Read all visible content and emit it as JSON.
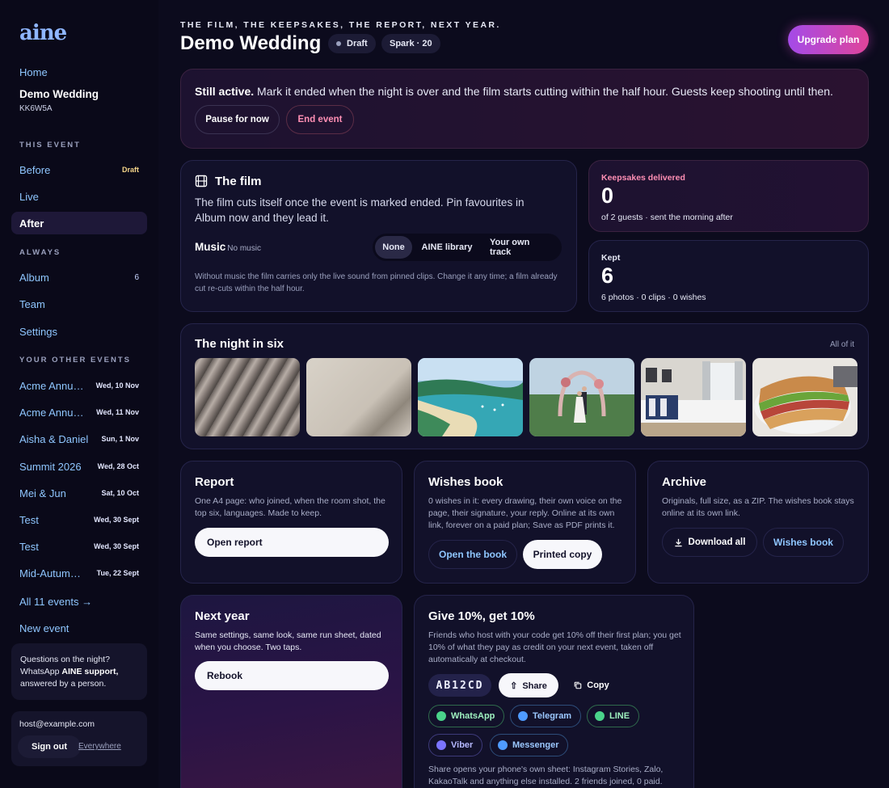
{
  "brand": {
    "logo": "aine"
  },
  "sidebar": {
    "home": "Home",
    "event_title": "Demo Wedding",
    "event_code": "KK6W5A",
    "this_event_label": "THIS EVENT",
    "this_event": [
      {
        "label": "Before",
        "badge": "Draft"
      },
      {
        "label": "Live"
      },
      {
        "label": "After",
        "active": true
      }
    ],
    "always_label": "ALWAYS",
    "always": [
      {
        "label": "Album",
        "count": "6"
      },
      {
        "label": "Team"
      },
      {
        "label": "Settings"
      }
    ],
    "other_label": "YOUR OTHER EVENTS",
    "other_events": [
      {
        "name": "Acme Annual ...",
        "date": "Wed, 10 Nov"
      },
      {
        "name": "Acme Annual ...",
        "date": "Wed, 11 Nov"
      },
      {
        "name": "Aisha & Daniel",
        "date": "Sun, 1 Nov"
      },
      {
        "name": "Summit 2026",
        "date": "Wed, 28 Oct"
      },
      {
        "name": "Mei & Jun",
        "date": "Sat, 10 Oct"
      },
      {
        "name": "Test",
        "date": "Wed, 30 Sept"
      },
      {
        "name": "Test",
        "date": "Wed, 30 Sept"
      },
      {
        "name": "Mid-Autumn ...",
        "date": "Tue, 22 Sept"
      }
    ],
    "all_events": "All 11 events →",
    "new_event": "New event",
    "support_line1": "Questions on the night?",
    "support_line2_pre": "WhatsApp ",
    "support_line2_bold": "AINE support,",
    "support_line3": "answered by a person.",
    "email": "host@example.com",
    "sign_out": "Sign out",
    "everywhere": "Everywhere"
  },
  "header": {
    "eyebrow": "THE FILM, THE KEEPSAKES, THE REPORT, NEXT YEAR.",
    "title": "Demo Wedding",
    "status_pill": "Draft",
    "plan_pill": "Spark · 20",
    "upgrade": "Upgrade plan"
  },
  "active_banner": {
    "bold": "Still active.",
    "text": " Mark it ended when the night is over and the film starts cutting within the half hour. Guests keep shooting until then.",
    "pause": "Pause for now",
    "end": "End event"
  },
  "film": {
    "title": "The film",
    "desc": "The film cuts itself once the event is marked ended. Pin favourites in Album now and they lead it.",
    "music_label": "Music",
    "music_sub": "No music",
    "options": [
      "None",
      "AINE library",
      "Your own track"
    ],
    "selected": "None",
    "note": "Without music the film carries only the live sound from pinned clips. Change it any time; a film already cut re-cuts within the half hour."
  },
  "keepsakes": {
    "label": "Keepsakes delivered",
    "value": "0",
    "sub": "of 2 guests · sent the morning after",
    "label_color": "#ff8fb4"
  },
  "kept": {
    "label": "Kept",
    "value": "6",
    "sub": "6 photos · 0 clips · 0 wishes"
  },
  "night": {
    "title": "The night in six",
    "link": "All of it"
  },
  "report": {
    "title": "Report",
    "desc": "One A4 page: who joined, when the room shot, the top six, languages. Made to keep.",
    "button": "Open report"
  },
  "wishes": {
    "title": "Wishes book",
    "desc": "0 wishes in it: every drawing, their own voice on the page, their signature, your reply. Online at its own link, forever on a paid plan; Save as PDF prints it.",
    "open": "Open the book",
    "printed": "Printed copy"
  },
  "archive": {
    "title": "Archive",
    "desc": "Originals, full size, as a ZIP. The wishes book stays online at its own link.",
    "download": "Download all",
    "wishes": "Wishes book"
  },
  "next_year": {
    "title": "Next year",
    "desc": "Same settings, same look, same run sheet, dated when you choose. Two taps.",
    "button": "Rebook"
  },
  "referral": {
    "title": "Give 10%, get 10%",
    "desc": "Friends who host with your code get 10% off their first plan; you get 10% of what they pay as credit on your next event, taken off automatically at checkout.",
    "code": "AB12CD",
    "share": "Share",
    "copy": "Copy",
    "channels": [
      "WhatsApp",
      "Telegram",
      "LINE",
      "Viber",
      "Messenger"
    ],
    "footnote": "Share opens your phone's own sheet: Instagram Stories, Zalo, KakaoTalk and anything else installed. 2 friends joined, 0 paid."
  }
}
